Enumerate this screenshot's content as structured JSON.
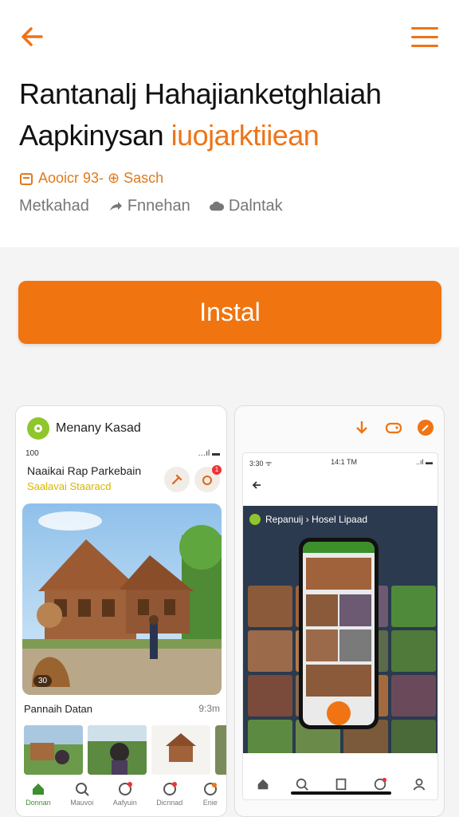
{
  "header": {
    "title_line1": "Rantanalj Hahajianketghlaiah",
    "title_line2_main": "Aapkinysan",
    "title_line2_accent": "iuojarktiiean",
    "meta_primary": "Aooicr 93- ⊕ Sasch",
    "meta_items": [
      "Metkahad",
      "Fnnehan",
      "Dalntak"
    ]
  },
  "install_button": {
    "label": "Instal"
  },
  "phone1": {
    "app_name": "Menany Kasad",
    "status_left": "100",
    "status_right": "…ıl ▬",
    "heading": "Naaikai Rap Parkebain",
    "subheading": "Saalavai Staaracd",
    "badge": "1",
    "hero_chip": "30",
    "section_title": "Pannaih Datan",
    "section_meta": "9:3m",
    "nav": [
      "Donnan",
      "Mauvoi",
      "Aafyuin",
      "Dicnnad",
      "Enie"
    ]
  },
  "phone2": {
    "status_left": "3:30 ᯤ",
    "status_center": "14:1 TM",
    "status_right": "..ıl ▬",
    "dark_title": "Repanuij › Hosel Lipaad"
  },
  "colors": {
    "accent": "#f0740f",
    "accent_text": "#e07a1c",
    "green": "#8fc62e",
    "yellow": "#d4b700"
  },
  "icons": [
    "back-arrow-icon",
    "hamburger-menu-icon",
    "calendar-icon",
    "share-icon",
    "cloud-icon",
    "home-icon",
    "search-icon",
    "chat-icon",
    "notification-icon",
    "profile-icon"
  ]
}
